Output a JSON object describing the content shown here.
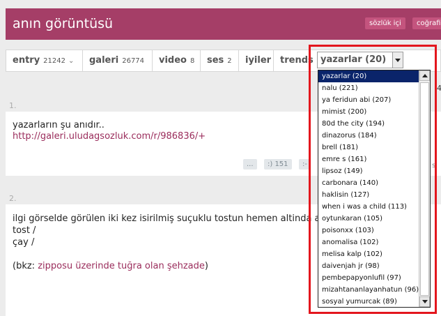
{
  "header": {
    "title": "anın görüntüsü",
    "buttons": [
      "sözlük içi",
      "coğrafi"
    ]
  },
  "tabs": [
    {
      "label": "entry",
      "count": "21242",
      "chevron": "⌄"
    },
    {
      "label": "galeri",
      "count": "26774"
    },
    {
      "label": "video",
      "count": "8"
    },
    {
      "label": "ses",
      "count": "2"
    },
    {
      "label": "iyiler"
    },
    {
      "label": "trends"
    }
  ],
  "author_select": {
    "selected": "yazarlar (20)",
    "options": [
      "yazarlar (20)",
      "nalu (221)",
      "ya feridun abi (207)",
      "mimist (200)",
      "80d the city (194)",
      "dinazorus (184)",
      "brell (181)",
      "emre s (161)",
      "lipsoz (149)",
      "carbonara (140)",
      "haklisin (127)",
      "when i was a child (113)",
      "oytunkaran (105)",
      "poisonxx (103)",
      "anomalisa (102)",
      "melisa kalp (102)",
      "daivenjah jr (98)",
      "pembepapyonlufil (97)",
      "mizahtananlayanhatun (96)",
      "sosyal yumurcak (89)"
    ]
  },
  "entries": [
    {
      "number": "1.",
      "text": "yazarların şu anıdır..",
      "link": "http://galeri.uludagsozluk.com/r/986836/+",
      "vote_buttons": [
        "...",
        ":) 151",
        ":-"
      ],
      "right_cut": "s"
    },
    {
      "number": "2.",
      "line1": "ilgi görselde görülen iki kez isirilmiş suçuklu tostun hemen altinda a",
      "line2": "tost /",
      "line3": "çay /",
      "bkz_prefix": "(bkz: ",
      "bkz_link": "zipposu üzerinde tuğra olan şehzade",
      "bkz_suffix": ")"
    }
  ],
  "side_cut_text": "4"
}
